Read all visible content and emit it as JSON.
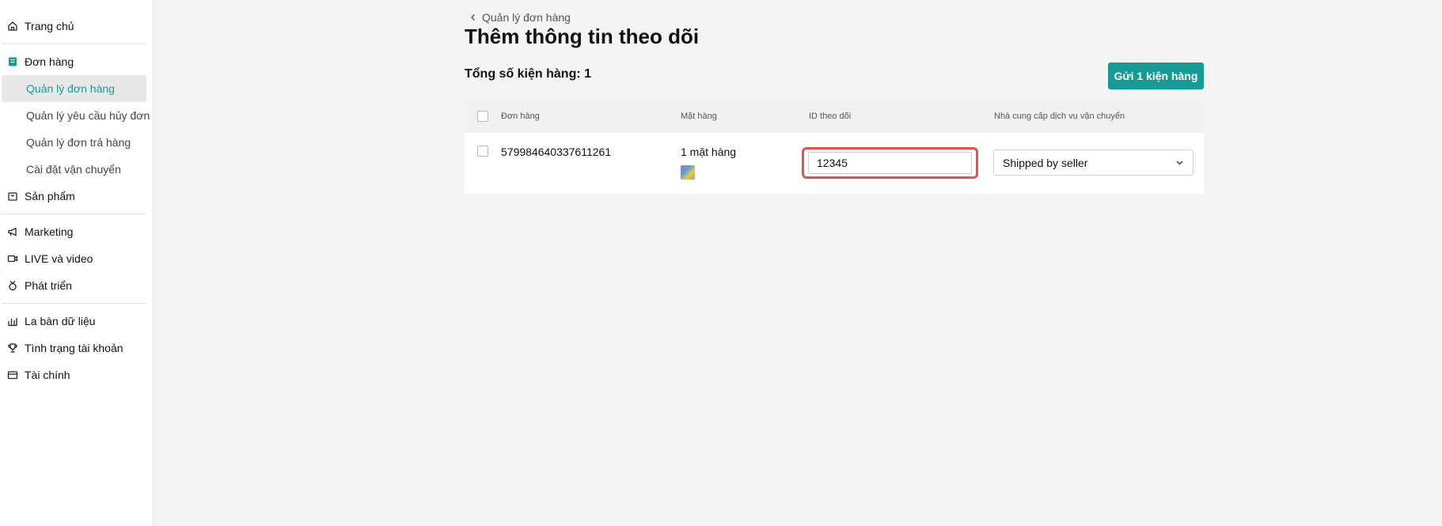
{
  "sidebar": {
    "home": "Trang chủ",
    "orders": "Đơn hàng",
    "orders_sub": [
      "Quản lý đơn hàng",
      "Quản lý yêu cầu hủy đơn",
      "Quản lý đơn trả hàng",
      "Cài đặt vận chuyển"
    ],
    "products": "Sản phẩm",
    "marketing": "Marketing",
    "live_video": "LIVE và video",
    "growth": "Phát triển",
    "data_compass": "La bàn dữ liệu",
    "account_health": "Tình trạng tài khoản",
    "finance": "Tài chính"
  },
  "breadcrumb": "Quản lý đơn hàng",
  "page_title": "Thêm thông tin theo dõi",
  "total_packages": "Tổng số kiện hàng: 1",
  "ship_button": "Gửi 1 kiện hàng",
  "table": {
    "headers": {
      "order": "Đơn hàng",
      "items": "Mặt hàng",
      "tracking_id": "ID theo dõi",
      "carrier": "Nhà cung cấp dịch vụ vận chuyển"
    },
    "rows": [
      {
        "order_id": "579984640337611261",
        "items": "1 mặt hàng",
        "tracking_id": "12345",
        "carrier": "Shipped by seller"
      }
    ]
  },
  "colors": {
    "accent": "#159a96",
    "highlight_border": "#e0524f",
    "active_bg": "#e8e8e8"
  }
}
